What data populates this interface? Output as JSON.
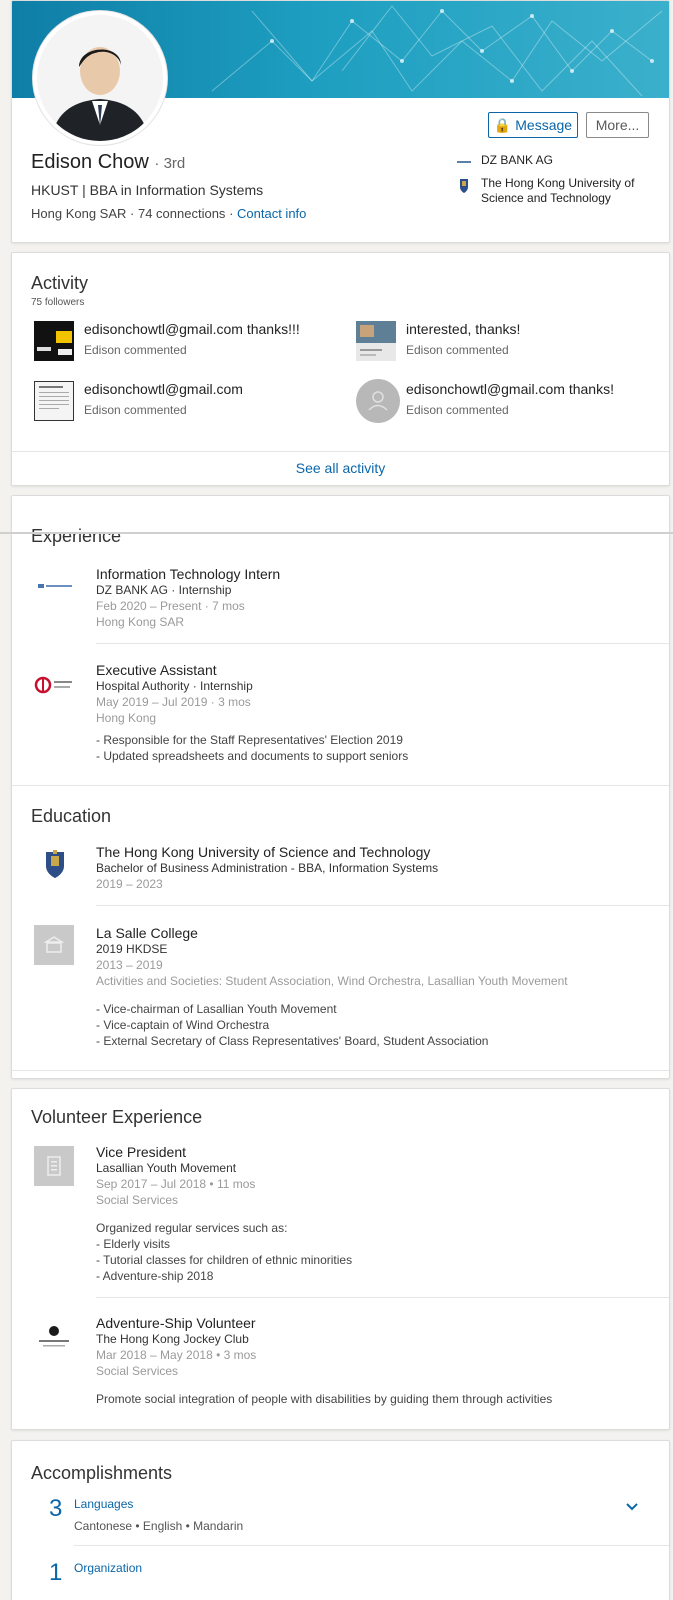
{
  "profile": {
    "name": "Edison Chow",
    "degree": "· 3rd",
    "headline": "HKUST | BBA in Information Systems",
    "location": "Hong Kong SAR",
    "connections": "74 connections",
    "contact_info": "Contact info",
    "message_label": "Message",
    "more_label": "More...",
    "company": "DZ BANK AG",
    "school": "The Hong Kong University of Science and Technology"
  },
  "activity": {
    "title": "Activity",
    "followers": "75 followers",
    "items": [
      {
        "text": "edisonchowtl@gmail.com thanks!!!",
        "meta": "Edison commented"
      },
      {
        "text": "interested, thanks!",
        "meta": "Edison commented"
      },
      {
        "text": "edisonchowtl@gmail.com",
        "meta": "Edison commented"
      },
      {
        "text": "edisonchowtl@gmail.com thanks!",
        "meta": "Edison commented"
      }
    ],
    "see_all": "See all activity"
  },
  "experience": {
    "title": "Experience",
    "jobs": [
      {
        "title": "Information Technology Intern",
        "company": "DZ BANK AG · Internship",
        "dates": "Feb 2020 – Present · 7 mos",
        "location": "Hong Kong SAR"
      },
      {
        "title": "Executive Assistant",
        "company": "Hospital Authority · Internship",
        "dates": "May 2019 – Jul 2019 · 3 mos",
        "location": "Hong Kong",
        "desc1": "- Responsible for the Staff Representatives' Election 2019",
        "desc2": "- Updated spreadsheets and documents to support seniors"
      }
    ]
  },
  "education": {
    "title": "Education",
    "schools": [
      {
        "name": "The Hong Kong University of Science and Technology",
        "degree": "Bachelor of Business Administration - BBA, Information Systems",
        "dates": "2019 – 2023"
      },
      {
        "name": "La Salle College",
        "degree": "2019 HKDSE",
        "dates": "2013 – 2019",
        "activities": "Activities and Societies: Student Association, Wind Orchestra, Lasallian Youth Movement",
        "desc1": "- Vice-chairman of Lasallian Youth Movement",
        "desc2": "- Vice-captain of Wind Orchestra",
        "desc3": "- External Secretary of Class Representatives' Board, Student Association"
      }
    ]
  },
  "volunteer": {
    "title": "Volunteer Experience",
    "roles": [
      {
        "title": "Vice President",
        "org": "Lasallian Youth Movement",
        "dates": "Sep 2017 – Jul 2018 • 11 mos",
        "cause": "Social Services",
        "desc0": "Organized regular services such as:",
        "desc1": "- Elderly visits",
        "desc2": "- Tutorial classes for children of ethnic minorities",
        "desc3": "- Adventure-ship 2018"
      },
      {
        "title": "Adventure-Ship Volunteer",
        "org": "The Hong Kong Jockey Club",
        "dates": "Mar 2018 – May 2018 • 3 mos",
        "cause": "Social Services",
        "desc0": "Promote social integration of people with disabilities by guiding them through activities"
      }
    ]
  },
  "accomplishments": {
    "title": "Accomplishments",
    "languages_count": "3",
    "languages_label": "Languages",
    "languages_list": "Cantonese • English • Mandarin",
    "org_count": "1",
    "org_label": "Organization"
  },
  "colors": {
    "accent": "#0a66a8",
    "banner": "#1d9ec0"
  }
}
